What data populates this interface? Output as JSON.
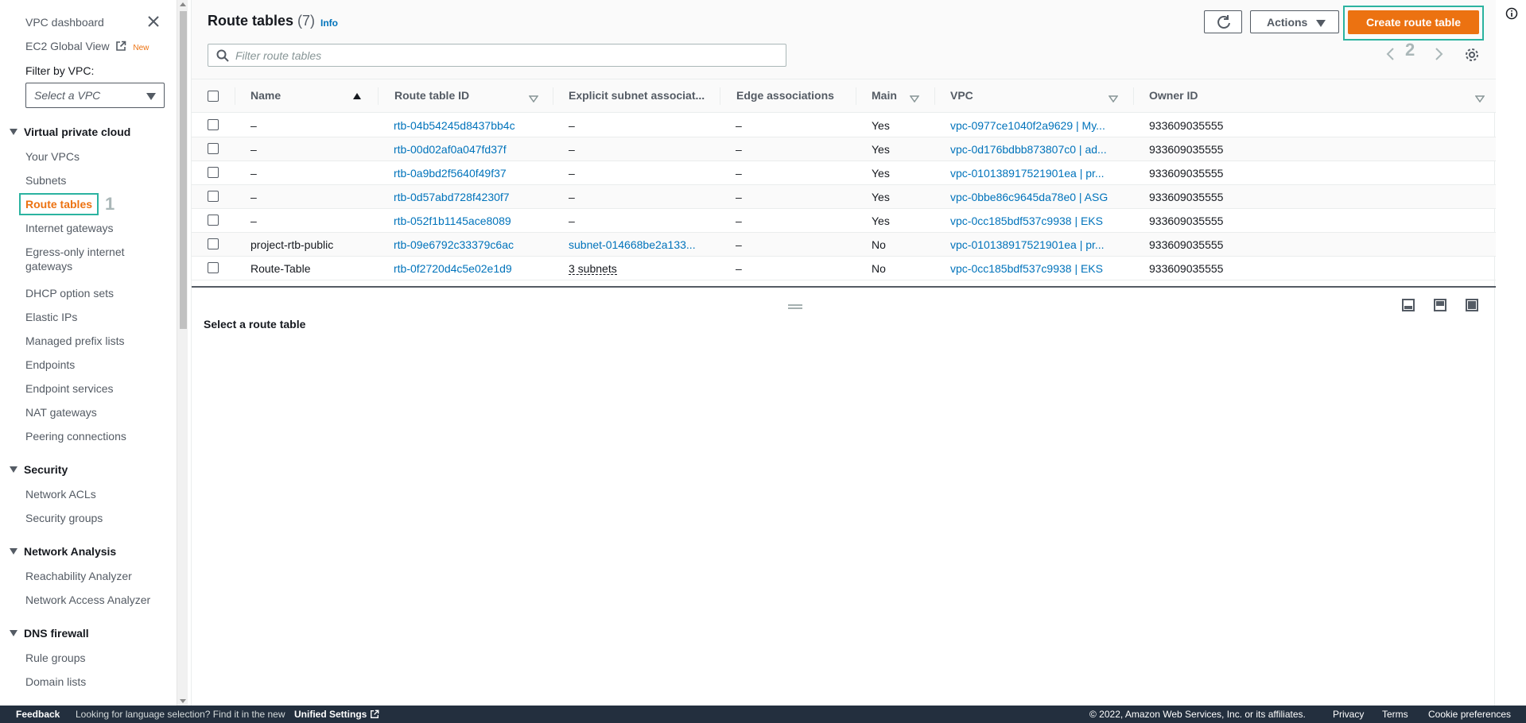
{
  "sidebar": {
    "dashboard": "VPC dashboard",
    "ec2_global_view": "EC2 Global View",
    "new_badge": "New",
    "filter_label": "Filter by VPC:",
    "vpc_select_placeholder": "Select a VPC",
    "sections": {
      "virtual_private_cloud": "Virtual private cloud",
      "security": "Security",
      "network_analysis": "Network Analysis",
      "dns_firewall": "DNS firewall"
    },
    "items": {
      "your_vpcs": "Your VPCs",
      "subnets": "Subnets",
      "route_tables": "Route tables",
      "internet_gateways": "Internet gateways",
      "egress_only_1": "Egress-only internet",
      "egress_only_2": "gateways",
      "dhcp_option_sets": "DHCP option sets",
      "elastic_ips": "Elastic IPs",
      "managed_prefix_lists": "Managed prefix lists",
      "endpoints": "Endpoints",
      "endpoint_services": "Endpoint services",
      "nat_gateways": "NAT gateways",
      "peering_connections": "Peering connections",
      "network_acls": "Network ACLs",
      "security_groups": "Security groups",
      "reachability_analyzer": "Reachability Analyzer",
      "network_access_analyzer": "Network Access Analyzer",
      "rule_groups": "Rule groups",
      "domain_lists": "Domain lists"
    },
    "step_badge": "1"
  },
  "header": {
    "title": "Route tables",
    "count": "(7)",
    "info": "Info",
    "filter_placeholder": "Filter route tables",
    "actions_label": "Actions",
    "create_label": "Create route table",
    "step_badge": "2"
  },
  "table": {
    "columns": {
      "name": "Name",
      "route_table_id": "Route table ID",
      "explicit_subnet": "Explicit subnet associat...",
      "edge_associations": "Edge associations",
      "main": "Main",
      "vpc": "VPC",
      "owner_id": "Owner ID"
    },
    "rows": [
      {
        "name": "–",
        "id": "rtb-04b54245d8437bb4c",
        "subnet": "–",
        "edge": "–",
        "main": "Yes",
        "vpc": "vpc-0977ce1040f2a9629 | My...",
        "owner": "933609035555"
      },
      {
        "name": "–",
        "id": "rtb-00d02af0a047fd37f",
        "subnet": "–",
        "edge": "–",
        "main": "Yes",
        "vpc": "vpc-0d176bdbb873807c0 | ad...",
        "owner": "933609035555"
      },
      {
        "name": "–",
        "id": "rtb-0a9bd2f5640f49f37",
        "subnet": "–",
        "edge": "–",
        "main": "Yes",
        "vpc": "vpc-010138917521901ea | pr...",
        "owner": "933609035555"
      },
      {
        "name": "–",
        "id": "rtb-0d57abd728f4230f7",
        "subnet": "–",
        "edge": "–",
        "main": "Yes",
        "vpc": "vpc-0bbe86c9645da78e0 | ASG",
        "owner": "933609035555"
      },
      {
        "name": "–",
        "id": "rtb-052f1b1145ace8089",
        "subnet": "–",
        "edge": "–",
        "main": "Yes",
        "vpc": "vpc-0cc185bdf537c9938 | EKS",
        "owner": "933609035555"
      },
      {
        "name": "project-rtb-public",
        "id": "rtb-09e6792c33379c6ac",
        "subnet": "subnet-014668be2a133...",
        "edge": "–",
        "main": "No",
        "vpc": "vpc-010138917521901ea | pr...",
        "owner": "933609035555"
      },
      {
        "name": "Route-Table",
        "id": "rtb-0f2720d4c5e02e1d9",
        "subnet": "3 subnets",
        "edge": "–",
        "main": "No",
        "vpc": "vpc-0cc185bdf537c9938 | EKS",
        "owner": "933609035555"
      }
    ]
  },
  "details": {
    "empty_message": "Select a route table"
  },
  "footer": {
    "feedback": "Feedback",
    "language_msg": "Looking for language selection? Find it in the new",
    "unified_settings": "Unified Settings",
    "copyright": "© 2022, Amazon Web Services, Inc. or its affiliates.",
    "privacy": "Privacy",
    "terms": "Terms",
    "cookie": "Cookie preferences"
  },
  "colors": {
    "accent": "#ec7211",
    "link": "#0073bb",
    "highlight": "#2bb3a0",
    "footer_bg": "#232f3e"
  }
}
